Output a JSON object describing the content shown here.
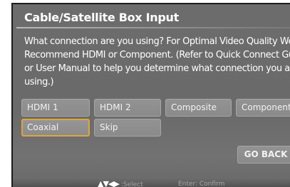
{
  "dialog": {
    "title": "Cable/Satellite Box Input",
    "description": "What connection are you using? For Optimal Video Quality We\nRecommend HDMI or Component. (Refer to Quick Connect Guide\nor User Manual to help you determine what connection you are\nusing.)"
  },
  "options": [
    {
      "label": "HDMI 1",
      "focused": false
    },
    {
      "label": "HDMI 2",
      "focused": false
    },
    {
      "label": "Composite",
      "focused": false
    },
    {
      "label": "Component",
      "focused": false
    },
    {
      "label": "Coaxial",
      "focused": true
    },
    {
      "label": "Skip",
      "focused": false
    }
  ],
  "go_back_label": "GO BACK",
  "hints": {
    "arrows": "▲▼◀▶",
    "select": ":Select",
    "confirm": "Enter: Confirm"
  },
  "colors": {
    "focus_border": "#e0a63a",
    "panel": "#6b6b6b",
    "button": "#8f8f8f"
  }
}
